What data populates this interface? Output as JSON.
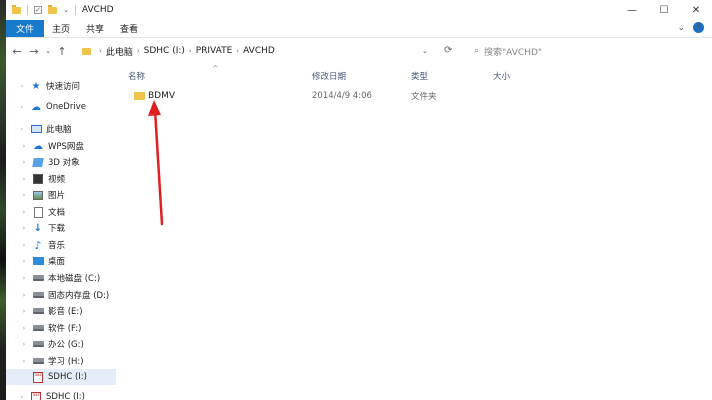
{
  "window": {
    "title": "AVCHD",
    "controls": {
      "minimize": "—",
      "maximize": "☐",
      "close": "✕"
    }
  },
  "ribbon": {
    "tabs": [
      {
        "label": "文件"
      },
      {
        "label": "主页"
      },
      {
        "label": "共享"
      },
      {
        "label": "查看"
      }
    ],
    "expand_glyph": "⌄",
    "help_glyph": "?"
  },
  "navigation": {
    "back": "←",
    "forward": "→",
    "history": "⌄",
    "up": "↑"
  },
  "address_bar": {
    "crumbs": [
      "此电脑",
      "SDHC (I:)",
      "PRIVATE",
      "AVCHD"
    ],
    "separator": "›",
    "dropdown": "⌄",
    "refresh": "⟳"
  },
  "search": {
    "icon": "⌕",
    "placeholder": "搜索\"AVCHD\""
  },
  "sidebar": {
    "items": [
      {
        "label": "快速访问",
        "icon": "star-icon"
      },
      {
        "label": "OneDrive",
        "icon": "cloud-icon"
      },
      {
        "label": "此电脑",
        "icon": "computer-icon"
      },
      {
        "label": "WPS网盘",
        "icon": "cloud-drive-icon"
      },
      {
        "label": "3D 对象",
        "icon": "cube-icon"
      },
      {
        "label": "视频",
        "icon": "video-icon"
      },
      {
        "label": "图片",
        "icon": "picture-icon"
      },
      {
        "label": "文档",
        "icon": "document-icon"
      },
      {
        "label": "下载",
        "icon": "download-icon"
      },
      {
        "label": "音乐",
        "icon": "music-icon"
      },
      {
        "label": "桌面",
        "icon": "desktop-icon"
      },
      {
        "label": "本地磁盘 (C:)",
        "icon": "drive-icon"
      },
      {
        "label": "固态内存盘 (D:)",
        "icon": "drive-icon"
      },
      {
        "label": "影音 (E:)",
        "icon": "drive-icon"
      },
      {
        "label": "软件 (F:)",
        "icon": "drive-icon"
      },
      {
        "label": "办公 (G:)",
        "icon": "drive-icon"
      },
      {
        "label": "学习 (H:)",
        "icon": "drive-icon"
      },
      {
        "label": "SDHC (I:)",
        "icon": "sd-card-icon",
        "selected": true
      },
      {
        "label": "SDHC (I:)",
        "icon": "sd-card-icon"
      }
    ],
    "expand_glyph": "›",
    "sd_icon_text": "SD"
  },
  "columns": {
    "name": "名称",
    "modified": "修改日期",
    "type": "类型",
    "size": "大小",
    "sort_glyph": "^"
  },
  "files": [
    {
      "name": "BDMV",
      "modified": "2014/4/9 4:06",
      "type": "文件夹",
      "size": ""
    }
  ],
  "colors": {
    "accent": "#1979ca",
    "annotation_arrow": "#e02020",
    "folder": "#f0c34a"
  }
}
